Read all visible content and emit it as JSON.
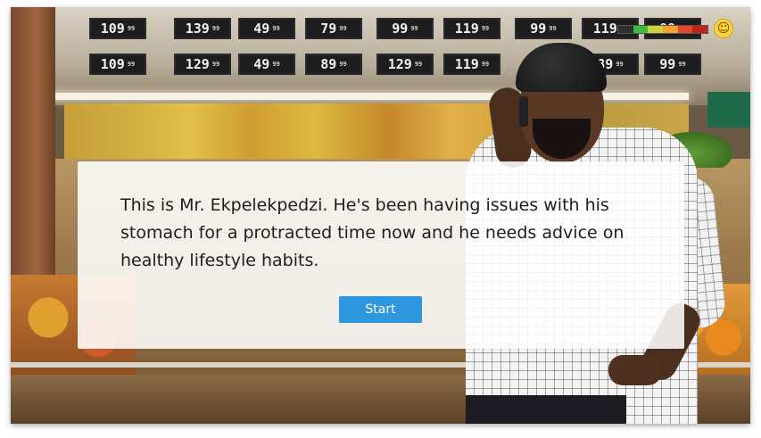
{
  "price_tags_row1": [
    "109",
    "139",
    "49",
    "79",
    "99",
    "119",
    "99",
    "119",
    "99"
  ],
  "price_tags_row2": [
    "109",
    "129",
    "49",
    "89",
    "129",
    "119",
    "89",
    "99"
  ],
  "price_cents": "99",
  "mood": {
    "icon": "smiley-face-icon",
    "colors": [
      "#2f2f2f",
      "#3fb93f",
      "#c8d43a",
      "#f2a22a",
      "#e04a2a",
      "#c4201c"
    ]
  },
  "dialog": {
    "text": "This is Mr. Ekpelekpedzi. He's been having issues with his stomach for a protracted time now and he needs advice on healthy lifestyle habits.",
    "start_label": "Start"
  },
  "colors": {
    "start_button": "#2f96e0",
    "card_bg": "rgba(255,255,255,0.88)"
  }
}
